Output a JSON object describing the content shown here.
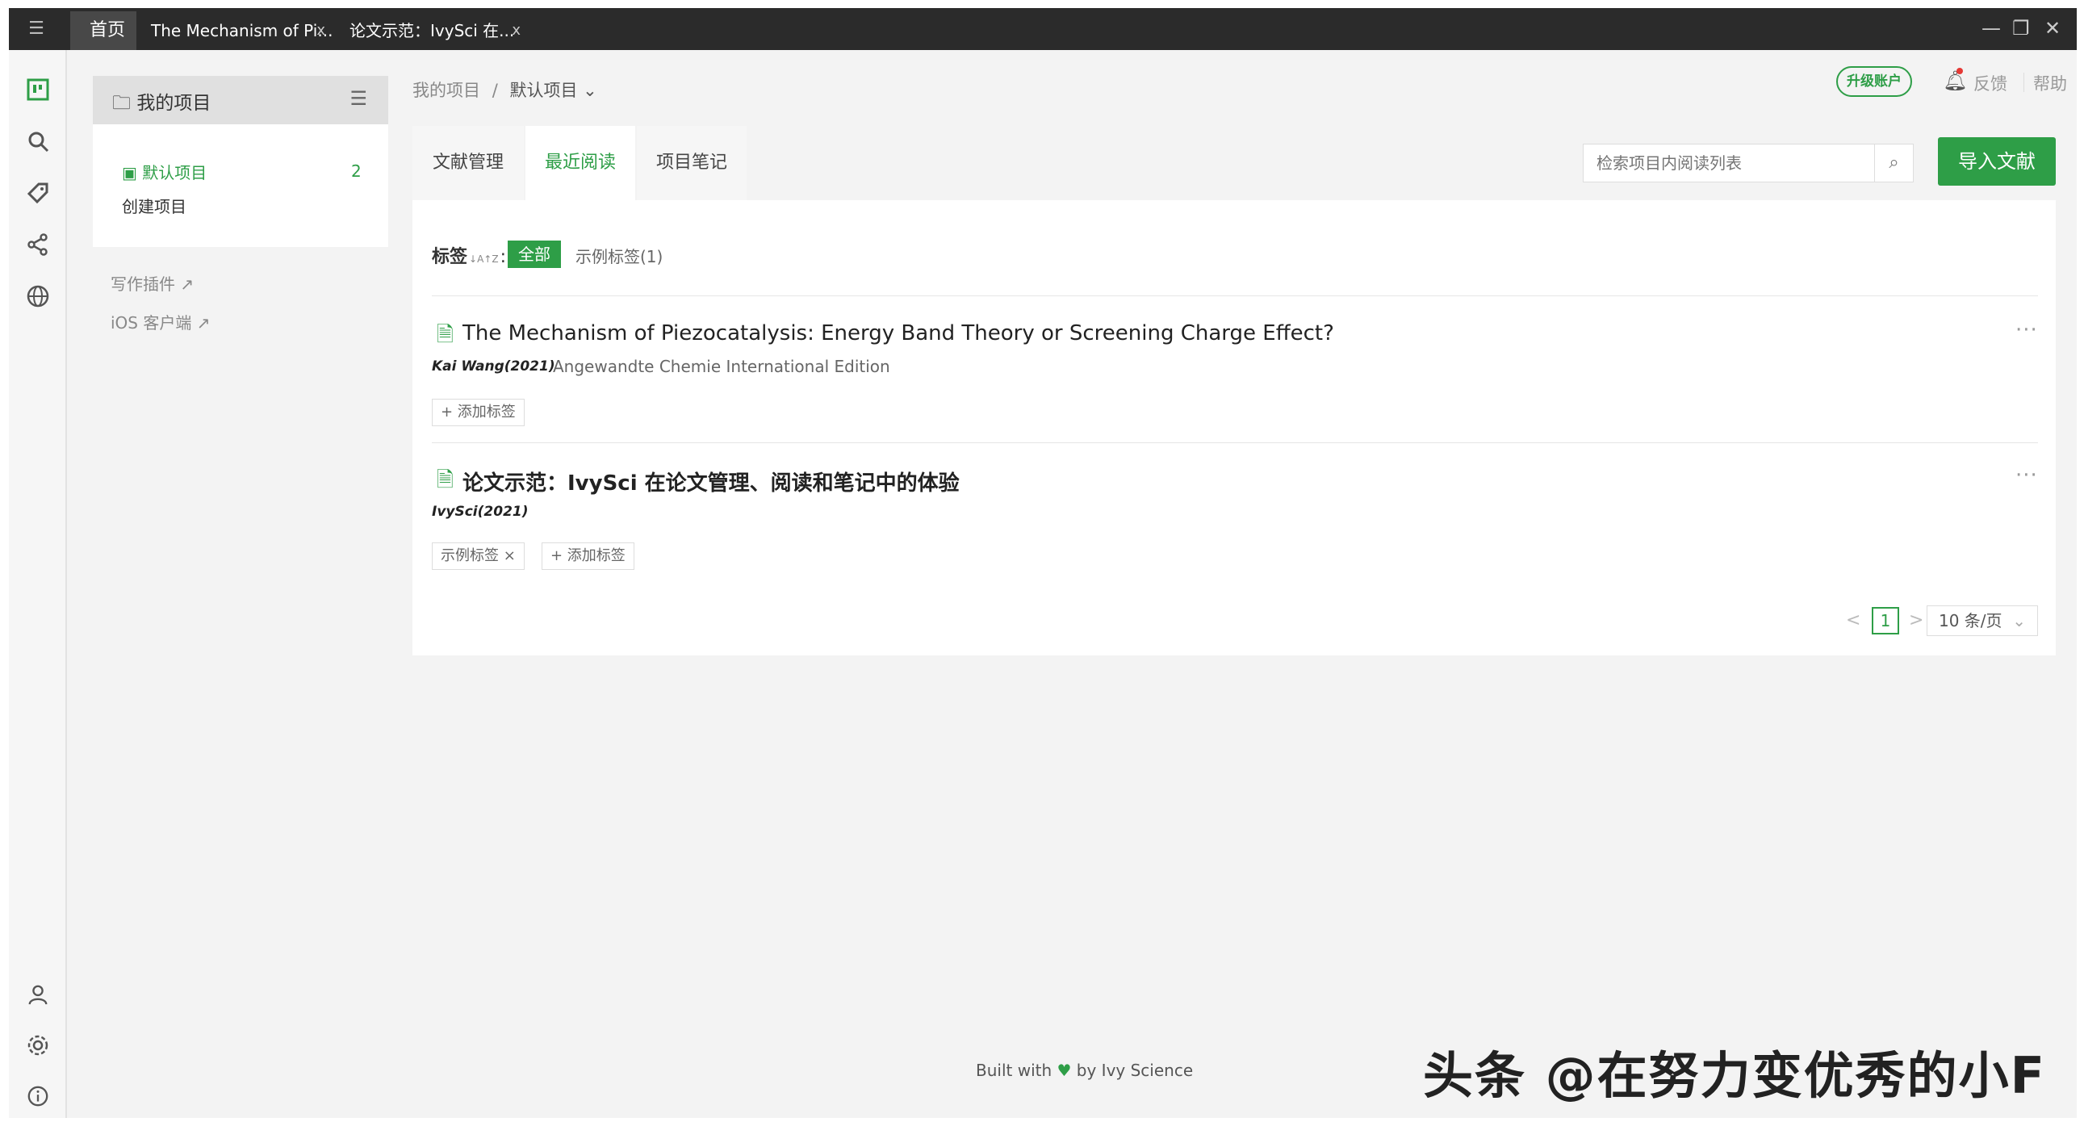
{
  "window": {
    "tabs": [
      {
        "label": "首页"
      },
      {
        "label": "The Mechanism of Pi...",
        "close": "x"
      },
      {
        "label": "论文示范：IvySci 在...",
        "close": "x"
      }
    ],
    "controls": {
      "minimize": "—",
      "restore": "❐",
      "close": "✕"
    }
  },
  "rail": {
    "icons": [
      "projects-icon",
      "search-icon",
      "tag-icon",
      "share-icon",
      "globe-icon",
      "user-icon",
      "settings-icon",
      "info-icon"
    ]
  },
  "sidebar": {
    "title": "我的项目",
    "items": [
      {
        "label": "默认项目",
        "count": "2"
      },
      {
        "label": "创建项目"
      }
    ],
    "links": [
      {
        "label": "写作插件"
      },
      {
        "label": "iOS 客户端"
      }
    ]
  },
  "header": {
    "breadcrumb_root": "我的项目",
    "breadcrumb_sep": "/",
    "breadcrumb_current": "默认项目",
    "upgrade": "升级账户",
    "feedback": "反馈",
    "help": "帮助"
  },
  "tabs": [
    {
      "label": "文献管理"
    },
    {
      "label": "最近阅读"
    },
    {
      "label": "项目笔记"
    }
  ],
  "search": {
    "placeholder": "检索项目内阅读列表"
  },
  "import_button": "导入文献",
  "tags": {
    "label": "标签",
    "sort_icon": "↓A↑Z",
    "colon": ":",
    "all": "全部",
    "example": "示例标签(1)"
  },
  "papers": [
    {
      "title": "The Mechanism of Piezocatalysis: Energy Band Theory or Screening Charge Effect?",
      "author": "Kai Wang(2021)",
      "journal": "Angewandte Chemie International Edition",
      "add_tag": "+ 添加标签"
    },
    {
      "title": "论文示范：IvySci 在论文管理、阅读和笔记中的体验",
      "author": "IvySci(2021)",
      "tag": "示例标签",
      "tag_remove": "×",
      "add_tag": "+ 添加标签"
    }
  ],
  "pagination": {
    "prev": "<",
    "page": "1",
    "next": ">",
    "page_size": "10 条/页"
  },
  "footer": {
    "built_with": "Built with",
    "heart": "♥",
    "by": "by Ivy Science"
  },
  "watermark": "头条 @在努力变优秀的小F"
}
